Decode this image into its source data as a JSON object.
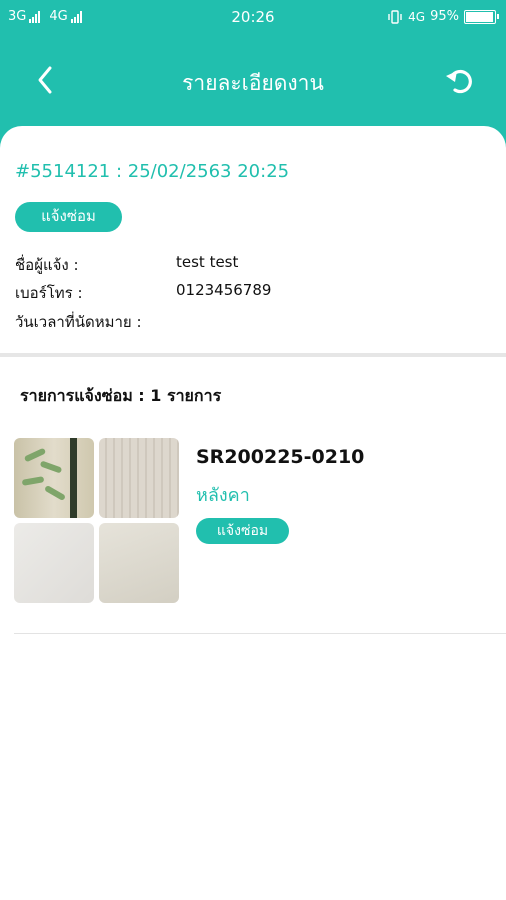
{
  "status_bar": {
    "network_1": "3G",
    "network_2": "4G",
    "time": "20:26",
    "network_3": "4G",
    "battery_text": "95%",
    "battery_level": 0.95
  },
  "header": {
    "title": "รายละเอียดงาน",
    "back_icon": "chevron-left-icon",
    "refresh_icon": "refresh-icon"
  },
  "job": {
    "id_line": "#5514121 : 25/02/2563 20:25",
    "status": "แจ้งซ่อม",
    "fields": [
      {
        "label": "ชื่อผู้แจ้ง :",
        "value": "test test"
      },
      {
        "label": "เบอร์โทร :",
        "value": "0123456789"
      },
      {
        "label": "วันเวลาที่นัดหมาย :",
        "value": ""
      }
    ]
  },
  "repair_list": {
    "title": "รายการแจ้งซ่อม : 1 รายการ",
    "items": [
      {
        "code": "SR200225-0210",
        "name": "หลังคา",
        "status": "แจ้งซ่อม"
      }
    ]
  },
  "colors": {
    "accent": "#21bfae"
  }
}
